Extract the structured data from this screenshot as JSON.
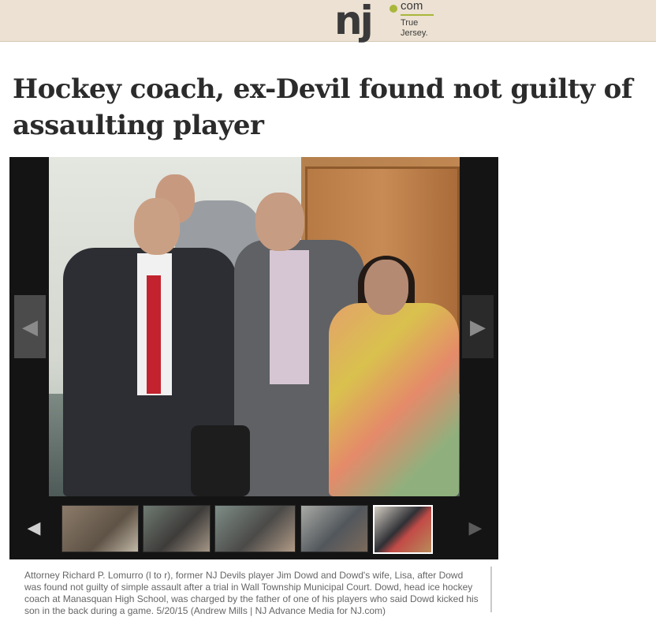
{
  "header": {
    "logo_mark": "nj",
    "logo_com": "com",
    "logo_tag_line1": "True",
    "logo_tag_line2": "Jersey.",
    "logo_accent": "#a8b73a"
  },
  "article": {
    "headline": "Hockey coach, ex-Devil found not guilty of assaulting player"
  },
  "gallery": {
    "prev_icon": "chevron-left-icon",
    "next_icon": "chevron-right-icon",
    "prev_glyph": "◀",
    "next_glyph": "▶",
    "thumbnails_count": 5,
    "selected_thumbnail": 5,
    "caption": "Attorney Richard P. Lomurro (l to r), former NJ Devils player Jim Dowd and Dowd's wife, Lisa, after Dowd was found not guilty of simple assault after a trial in Wall Township Municipal Court. Dowd, head ice hockey coach at Manasquan High School, was charged by the father of one of his players who said Dowd kicked his son in the back during a game. 5/20/15 (Andrew Mills | NJ Advance Media for NJ.com)"
  },
  "colors": {
    "header_bg": "#ece1d2",
    "gallery_bg": "#141414",
    "caption_text": "#666666"
  }
}
